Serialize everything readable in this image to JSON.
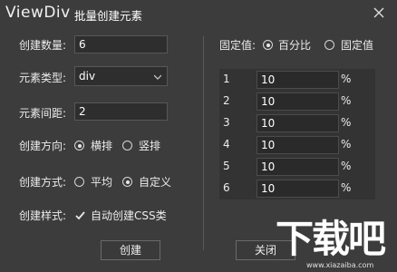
{
  "titlebar": {
    "app_name": "ViewDiv",
    "title": "批量创建元素",
    "close_icon": "close-icon"
  },
  "form": {
    "count_label": "创建数量:",
    "count_value": "6",
    "type_label": "元素类型:",
    "type_value": "div",
    "spacing_label": "元素间距:",
    "spacing_value": "2",
    "direction_label": "创建方向:",
    "direction_options": [
      "横排",
      "竖排"
    ],
    "direction_selected": "横排",
    "method_label": "创建方式:",
    "method_options": [
      "平均",
      "自定义"
    ],
    "method_selected": "自定义",
    "style_label": "创建样式:",
    "style_checkbox_label": "自动创建CSS类",
    "style_checked": true
  },
  "fixed": {
    "label": "固定值:",
    "options": [
      "百分比",
      "固定值"
    ],
    "selected": "百分比"
  },
  "table": {
    "rows": [
      {
        "index": "1",
        "value": "10",
        "unit": "%"
      },
      {
        "index": "2",
        "value": "10",
        "unit": "%"
      },
      {
        "index": "3",
        "value": "10",
        "unit": "%"
      },
      {
        "index": "4",
        "value": "10",
        "unit": "%"
      },
      {
        "index": "5",
        "value": "10",
        "unit": "%"
      },
      {
        "index": "6",
        "value": "10",
        "unit": "%"
      }
    ]
  },
  "buttons": {
    "create": "创建",
    "close": "关闭"
  },
  "watermark": {
    "logo_text": "下载吧",
    "url": "www.xiazaiba.com"
  },
  "colors": {
    "background": "#3c3c3c",
    "input_bg": "#2e2e2e",
    "text": "#ececec",
    "border": "#575757"
  }
}
